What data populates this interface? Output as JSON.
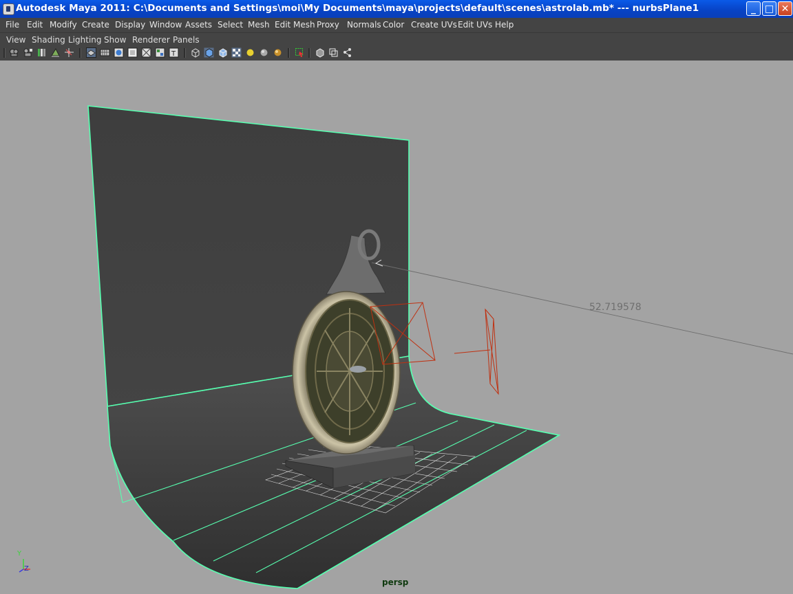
{
  "window": {
    "title": "Autodesk Maya 2011: C:\\Documents and Settings\\moi\\My Documents\\maya\\projects\\default\\scenes\\astrolab.mb*   ---   nurbsPlane1",
    "controls": [
      "_",
      "□",
      "✕"
    ]
  },
  "menubar": {
    "items": [
      "File",
      "Edit",
      "Modify",
      "Create",
      "Display",
      "Window",
      "Assets",
      "Select",
      "Mesh",
      "Edit Mesh",
      "Proxy",
      "Normals",
      "Color",
      "Create UVs",
      "Edit UVs",
      "Help"
    ]
  },
  "panel_menu": {
    "items": [
      "View",
      "Shading",
      "Lighting",
      "Show",
      "Renderer",
      "Panels"
    ]
  },
  "toolbar": {
    "icons": [
      "camera-icon",
      "camera-attributes-icon",
      "bookmarks-icon",
      "image-plane-icon",
      "2d-pan-icon",
      "grease-pencil-icon",
      "grid-icon",
      "film-gate-icon",
      "resolution-gate-icon",
      "gate-mask-icon",
      "field-chart-icon",
      "safe-action-icon",
      "safe-title-icon",
      "wireframe-icon",
      "smooth-shade-icon",
      "wireframe-on-shaded-icon",
      "textured-icon",
      "use-all-lights-icon",
      "shadows-icon",
      "high-quality-icon",
      "isolate-select-icon",
      "xray-icon",
      "xray-joints-icon",
      "backface-icon"
    ]
  },
  "viewport": {
    "camera_name": "persp",
    "distance_readout": "52.719578",
    "axis_labels": {
      "y": "Y",
      "z": "Z"
    },
    "colors": {
      "background": "#a3a3a3",
      "selection_highlight": "#57ffb0",
      "wire_dark": "#2a2a2a",
      "camera_wire": "#c03010"
    }
  }
}
